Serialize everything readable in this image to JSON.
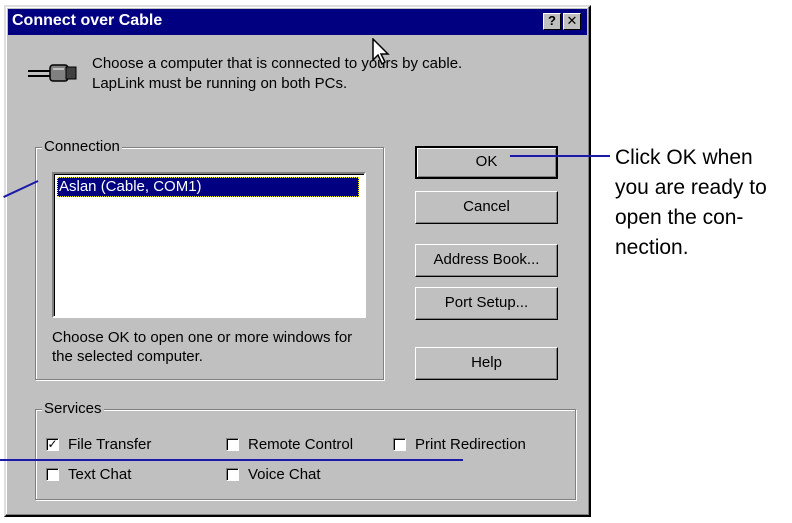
{
  "dialog": {
    "title": "Connect over Cable",
    "help_glyph": "?",
    "close_glyph": "✕",
    "intro": "Choose a computer that is connected to yours by cable.  LapLink must be running on both PCs."
  },
  "connection": {
    "label": "Connection",
    "items": [
      "Aslan (Cable, COM1)"
    ],
    "hint": "Choose OK to open one or more windows for the selected computer."
  },
  "buttons": {
    "ok": "OK",
    "cancel": "Cancel",
    "address_book": "Address Book...",
    "port_setup": "Port Setup...",
    "help": "Help"
  },
  "services": {
    "label": "Services",
    "file_transfer": {
      "label": "File Transfer",
      "checked": true
    },
    "remote_control": {
      "label": "Remote Control",
      "checked": false
    },
    "print_redirection": {
      "label": "Print Redirection",
      "checked": false
    },
    "text_chat": {
      "label": "Text Chat",
      "checked": false
    },
    "voice_chat": {
      "label": "Voice Chat",
      "checked": false
    }
  },
  "callout": {
    "text": "Click OK when you are ready to open the con-nection."
  },
  "colors": {
    "title_bar": "#000080",
    "dialog_face": "#c0c0c0",
    "callout_line": "#1a1aa8"
  },
  "icons": [
    "cable-icon",
    "help-icon",
    "close-icon",
    "mouse-cursor-icon",
    "check-icon"
  ]
}
